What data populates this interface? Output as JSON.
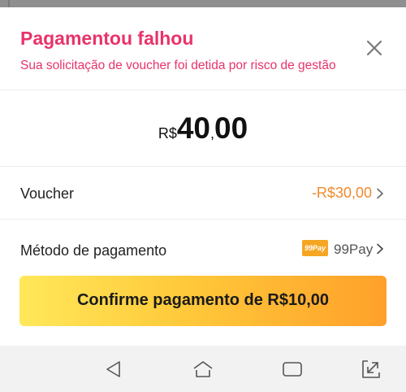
{
  "dialog": {
    "title": "Pagamentou falhou",
    "subtitle": "Sua solicitação de voucher foi detida por risco de gestão",
    "close_icon": "close-icon"
  },
  "amount": {
    "currency": "R$",
    "integer": "40",
    "separator": ",",
    "decimal": "00"
  },
  "voucher": {
    "label": "Voucher",
    "value": "-R$30,00",
    "value_color": "#f08a2c"
  },
  "payment_method": {
    "label": "Método de pagamento",
    "logo_text": "99Pay",
    "name": "99Pay"
  },
  "confirm_button": {
    "label": "Confirme pagamento de R$10,00"
  },
  "colors": {
    "accent": "#e8336a",
    "button_gradient_start": "#ffe85a",
    "button_gradient_end": "#ffa02a"
  },
  "navbar": {
    "icons": [
      "back-icon",
      "home-icon",
      "recent-apps-icon",
      "rotate-icon"
    ]
  }
}
